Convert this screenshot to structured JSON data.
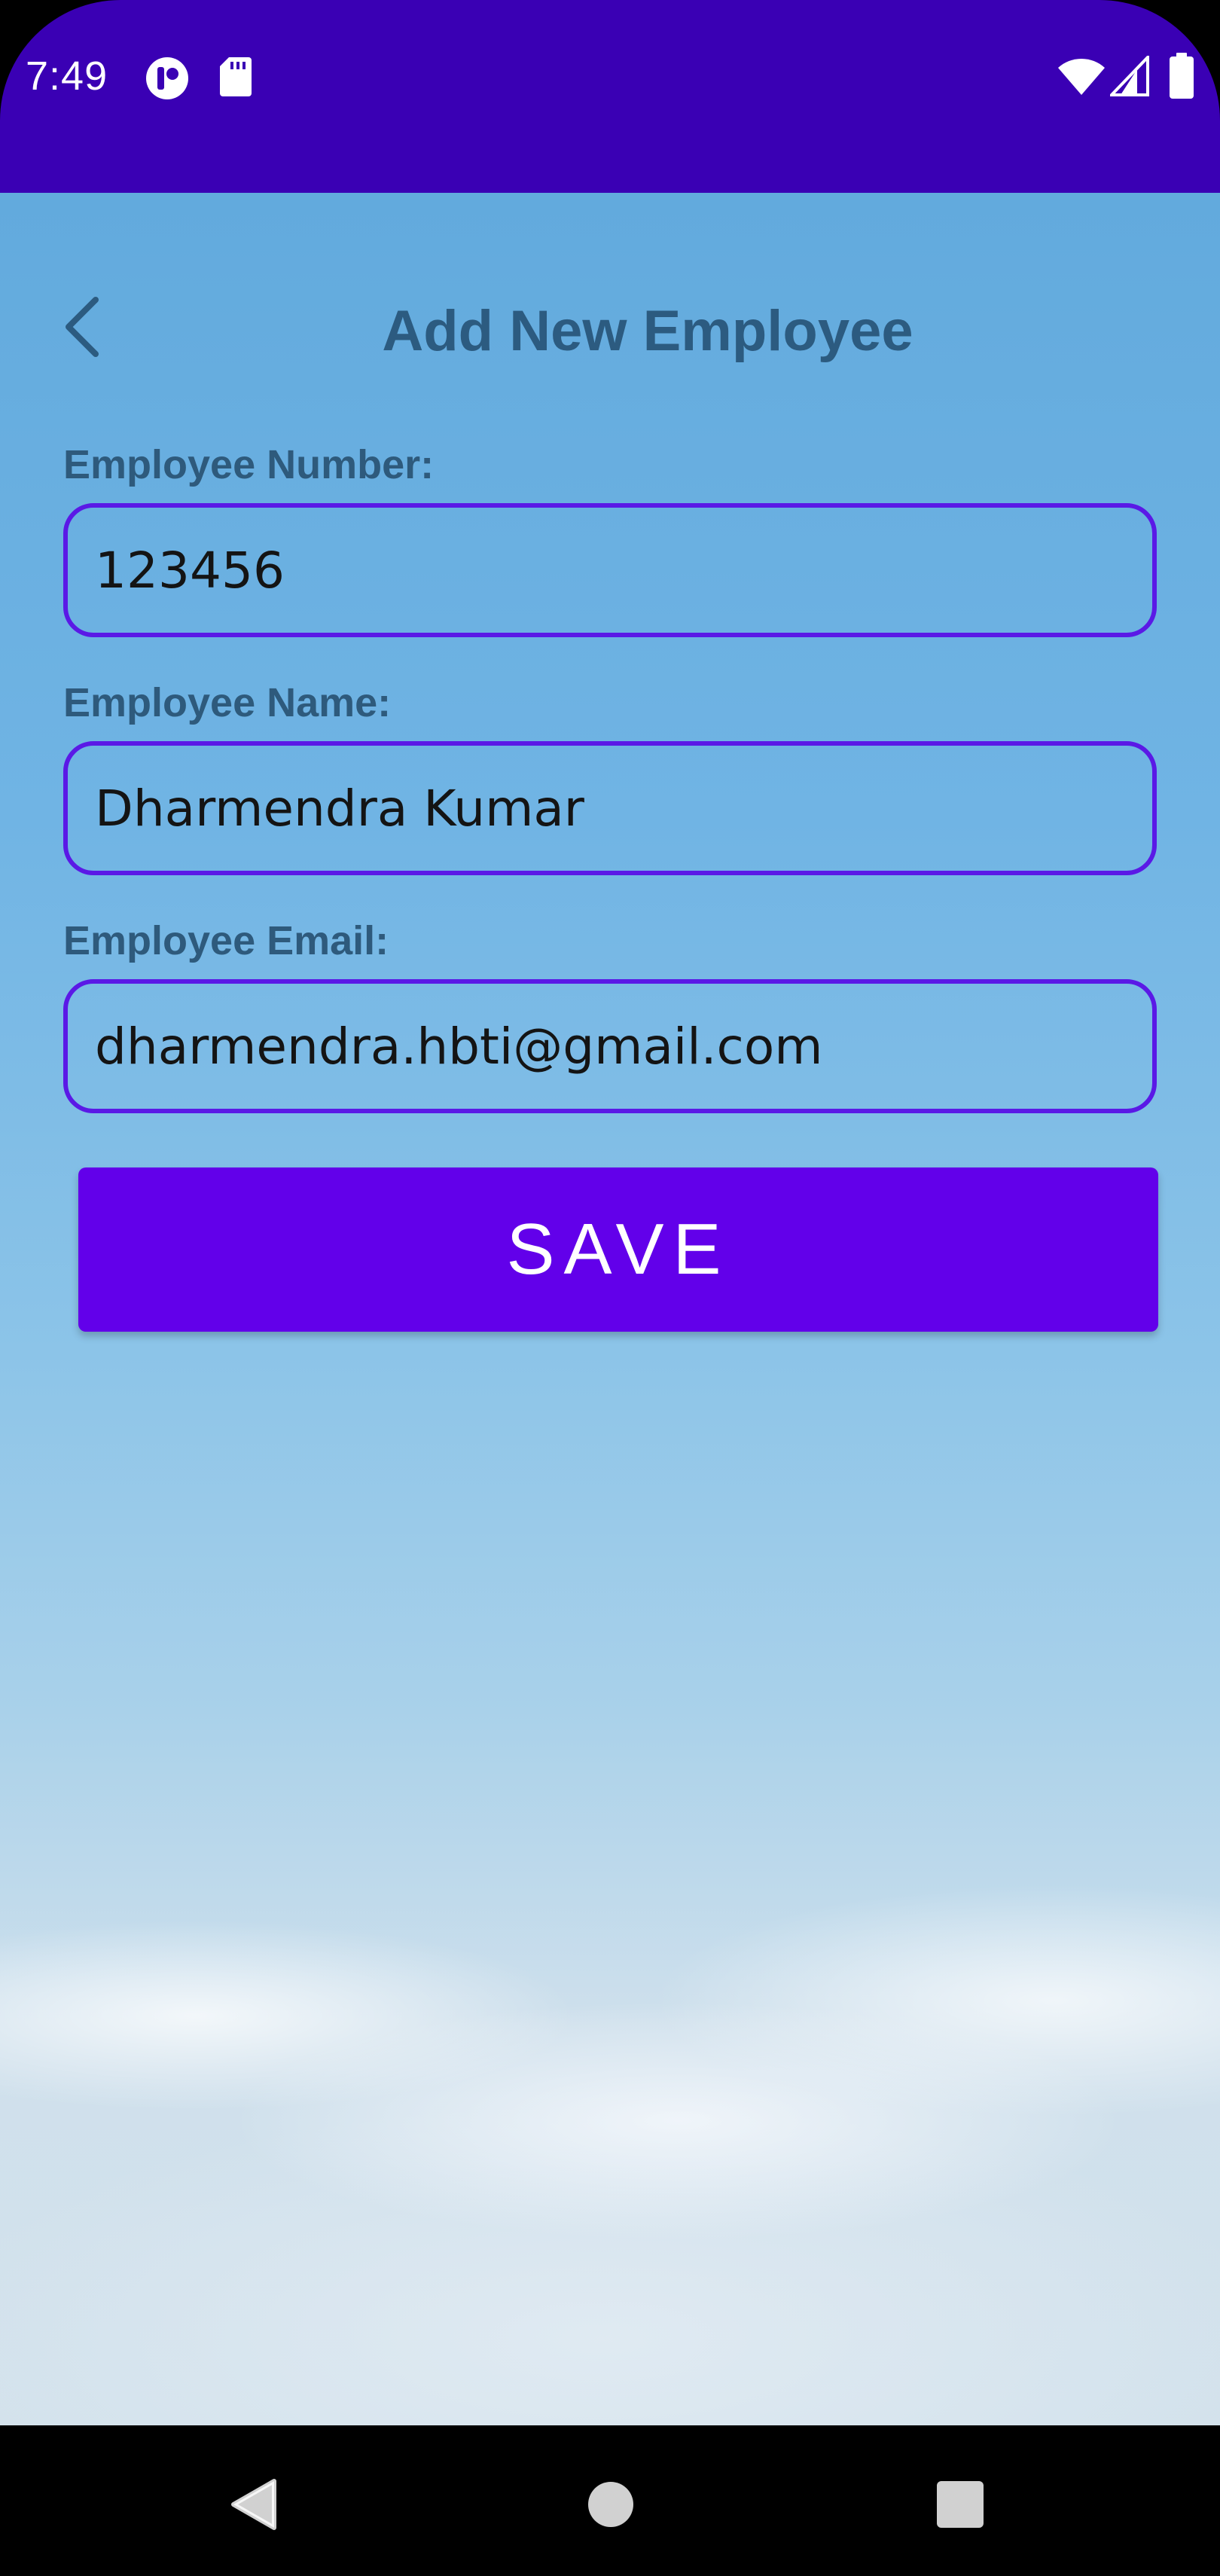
{
  "status_bar": {
    "time": "7:49",
    "icons": [
      "notification-app-icon",
      "sd-card-icon",
      "wifi-icon",
      "cellular-signal-icon",
      "battery-icon"
    ],
    "background_color": "#3a00b4"
  },
  "header": {
    "title": "Add New Employee",
    "back_icon": "back-arrow-icon"
  },
  "form": {
    "employee_number": {
      "label": "Employee Number:",
      "value": "123456"
    },
    "employee_name": {
      "label": "Employee Name:",
      "value": "Dharmendra Kumar"
    },
    "employee_email": {
      "label": "Employee Email:",
      "value": "dharmendra.hbti@gmail.com"
    },
    "save_label": "SAVE",
    "accent_color": "#6200ea",
    "field_border_color": "#5a19e6"
  },
  "nav_bar": {
    "buttons": [
      "back-triangle-icon",
      "home-circle-icon",
      "recents-square-icon"
    ]
  }
}
